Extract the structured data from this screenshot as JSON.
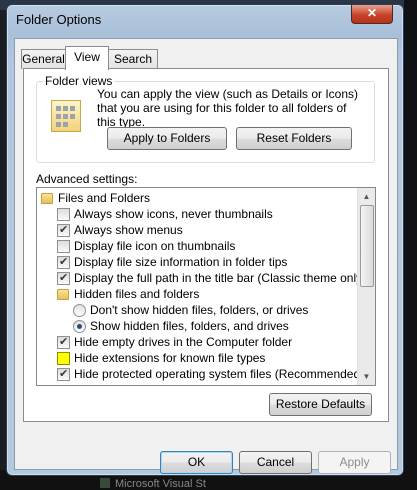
{
  "window": {
    "title": "Folder Options",
    "close_label": "✕"
  },
  "tabs": [
    {
      "label": "General"
    },
    {
      "label": "View"
    },
    {
      "label": "Search"
    }
  ],
  "folder_views": {
    "group_label": "Folder views",
    "description": "You can apply the view (such as Details or Icons) that you are using for this folder to all folders of this type.",
    "apply_label": "Apply to Folders",
    "reset_label": "Reset Folders"
  },
  "advanced": {
    "label": "Advanced settings:",
    "items": [
      {
        "kind": "folder",
        "indent": 0,
        "label": "Files and Folders"
      },
      {
        "kind": "check",
        "indent": 1,
        "checked": false,
        "label": "Always show icons, never thumbnails"
      },
      {
        "kind": "check",
        "indent": 1,
        "checked": true,
        "label": "Always show menus"
      },
      {
        "kind": "check",
        "indent": 1,
        "checked": false,
        "label": "Display file icon on thumbnails"
      },
      {
        "kind": "check",
        "indent": 1,
        "checked": true,
        "label": "Display file size information in folder tips"
      },
      {
        "kind": "check",
        "indent": 1,
        "checked": true,
        "label": "Display the full path in the title bar (Classic theme only)"
      },
      {
        "kind": "folder",
        "indent": 1,
        "label": "Hidden files and folders"
      },
      {
        "kind": "radio",
        "indent": 2,
        "checked": false,
        "label": "Don't show hidden files, folders, or drives"
      },
      {
        "kind": "radio",
        "indent": 2,
        "checked": true,
        "label": "Show hidden files, folders, and drives"
      },
      {
        "kind": "check",
        "indent": 1,
        "checked": true,
        "label": "Hide empty drives in the Computer folder"
      },
      {
        "kind": "check",
        "indent": 1,
        "checked": false,
        "highlight": true,
        "label": "Hide extensions for known file types"
      },
      {
        "kind": "check",
        "indent": 1,
        "checked": true,
        "label": "Hide protected operating system files (Recommended)"
      }
    ],
    "restore_label": "Restore Defaults"
  },
  "footer": {
    "ok_label": "OK",
    "cancel_label": "Cancel",
    "apply_label": "Apply"
  },
  "background": {
    "taskbar_text": "Microsoft Visual St"
  },
  "colors": {
    "highlight": "#ffff00",
    "title_bar": "#b5c9de",
    "close": "#c6432a"
  }
}
